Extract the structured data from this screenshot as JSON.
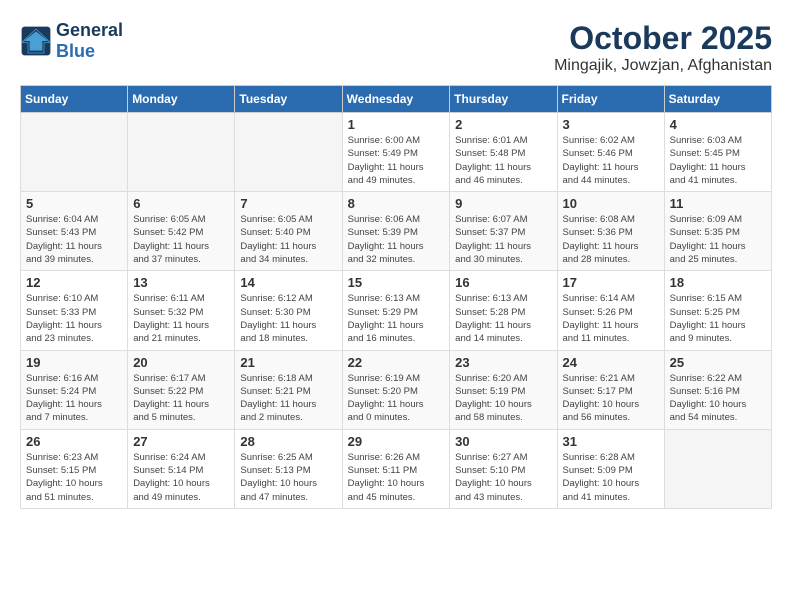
{
  "header": {
    "logo_general": "General",
    "logo_blue": "Blue",
    "month": "October 2025",
    "location": "Mingajik, Jowzjan, Afghanistan"
  },
  "weekdays": [
    "Sunday",
    "Monday",
    "Tuesday",
    "Wednesday",
    "Thursday",
    "Friday",
    "Saturday"
  ],
  "weeks": [
    [
      {
        "day": "",
        "info": ""
      },
      {
        "day": "",
        "info": ""
      },
      {
        "day": "",
        "info": ""
      },
      {
        "day": "1",
        "info": "Sunrise: 6:00 AM\nSunset: 5:49 PM\nDaylight: 11 hours\nand 49 minutes."
      },
      {
        "day": "2",
        "info": "Sunrise: 6:01 AM\nSunset: 5:48 PM\nDaylight: 11 hours\nand 46 minutes."
      },
      {
        "day": "3",
        "info": "Sunrise: 6:02 AM\nSunset: 5:46 PM\nDaylight: 11 hours\nand 44 minutes."
      },
      {
        "day": "4",
        "info": "Sunrise: 6:03 AM\nSunset: 5:45 PM\nDaylight: 11 hours\nand 41 minutes."
      }
    ],
    [
      {
        "day": "5",
        "info": "Sunrise: 6:04 AM\nSunset: 5:43 PM\nDaylight: 11 hours\nand 39 minutes."
      },
      {
        "day": "6",
        "info": "Sunrise: 6:05 AM\nSunset: 5:42 PM\nDaylight: 11 hours\nand 37 minutes."
      },
      {
        "day": "7",
        "info": "Sunrise: 6:05 AM\nSunset: 5:40 PM\nDaylight: 11 hours\nand 34 minutes."
      },
      {
        "day": "8",
        "info": "Sunrise: 6:06 AM\nSunset: 5:39 PM\nDaylight: 11 hours\nand 32 minutes."
      },
      {
        "day": "9",
        "info": "Sunrise: 6:07 AM\nSunset: 5:37 PM\nDaylight: 11 hours\nand 30 minutes."
      },
      {
        "day": "10",
        "info": "Sunrise: 6:08 AM\nSunset: 5:36 PM\nDaylight: 11 hours\nand 28 minutes."
      },
      {
        "day": "11",
        "info": "Sunrise: 6:09 AM\nSunset: 5:35 PM\nDaylight: 11 hours\nand 25 minutes."
      }
    ],
    [
      {
        "day": "12",
        "info": "Sunrise: 6:10 AM\nSunset: 5:33 PM\nDaylight: 11 hours\nand 23 minutes."
      },
      {
        "day": "13",
        "info": "Sunrise: 6:11 AM\nSunset: 5:32 PM\nDaylight: 11 hours\nand 21 minutes."
      },
      {
        "day": "14",
        "info": "Sunrise: 6:12 AM\nSunset: 5:30 PM\nDaylight: 11 hours\nand 18 minutes."
      },
      {
        "day": "15",
        "info": "Sunrise: 6:13 AM\nSunset: 5:29 PM\nDaylight: 11 hours\nand 16 minutes."
      },
      {
        "day": "16",
        "info": "Sunrise: 6:13 AM\nSunset: 5:28 PM\nDaylight: 11 hours\nand 14 minutes."
      },
      {
        "day": "17",
        "info": "Sunrise: 6:14 AM\nSunset: 5:26 PM\nDaylight: 11 hours\nand 11 minutes."
      },
      {
        "day": "18",
        "info": "Sunrise: 6:15 AM\nSunset: 5:25 PM\nDaylight: 11 hours\nand 9 minutes."
      }
    ],
    [
      {
        "day": "19",
        "info": "Sunrise: 6:16 AM\nSunset: 5:24 PM\nDaylight: 11 hours\nand 7 minutes."
      },
      {
        "day": "20",
        "info": "Sunrise: 6:17 AM\nSunset: 5:22 PM\nDaylight: 11 hours\nand 5 minutes."
      },
      {
        "day": "21",
        "info": "Sunrise: 6:18 AM\nSunset: 5:21 PM\nDaylight: 11 hours\nand 2 minutes."
      },
      {
        "day": "22",
        "info": "Sunrise: 6:19 AM\nSunset: 5:20 PM\nDaylight: 11 hours\nand 0 minutes."
      },
      {
        "day": "23",
        "info": "Sunrise: 6:20 AM\nSunset: 5:19 PM\nDaylight: 10 hours\nand 58 minutes."
      },
      {
        "day": "24",
        "info": "Sunrise: 6:21 AM\nSunset: 5:17 PM\nDaylight: 10 hours\nand 56 minutes."
      },
      {
        "day": "25",
        "info": "Sunrise: 6:22 AM\nSunset: 5:16 PM\nDaylight: 10 hours\nand 54 minutes."
      }
    ],
    [
      {
        "day": "26",
        "info": "Sunrise: 6:23 AM\nSunset: 5:15 PM\nDaylight: 10 hours\nand 51 minutes."
      },
      {
        "day": "27",
        "info": "Sunrise: 6:24 AM\nSunset: 5:14 PM\nDaylight: 10 hours\nand 49 minutes."
      },
      {
        "day": "28",
        "info": "Sunrise: 6:25 AM\nSunset: 5:13 PM\nDaylight: 10 hours\nand 47 minutes."
      },
      {
        "day": "29",
        "info": "Sunrise: 6:26 AM\nSunset: 5:11 PM\nDaylight: 10 hours\nand 45 minutes."
      },
      {
        "day": "30",
        "info": "Sunrise: 6:27 AM\nSunset: 5:10 PM\nDaylight: 10 hours\nand 43 minutes."
      },
      {
        "day": "31",
        "info": "Sunrise: 6:28 AM\nSunset: 5:09 PM\nDaylight: 10 hours\nand 41 minutes."
      },
      {
        "day": "",
        "info": ""
      }
    ]
  ]
}
